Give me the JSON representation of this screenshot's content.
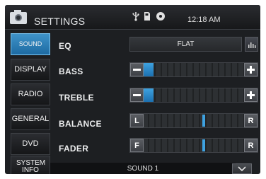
{
  "header": {
    "title": "SETTINGS",
    "time": "12:18 AM"
  },
  "sidebar": {
    "items": [
      {
        "label": "SOUND"
      },
      {
        "label": "DISPLAY"
      },
      {
        "label": "RADIO"
      },
      {
        "label": "GENERAL"
      },
      {
        "label": "DVD"
      },
      {
        "label": "SYSTEM INFO"
      }
    ]
  },
  "settings": {
    "eq": {
      "label": "EQ",
      "value": "FLAT"
    },
    "bass": {
      "label": "BASS",
      "level_fraction": 0.1
    },
    "treble": {
      "label": "TREBLE",
      "level_fraction": 0.1
    },
    "balance": {
      "label": "BALANCE",
      "left": "L",
      "right": "R",
      "position_fraction": 0.6
    },
    "fader": {
      "label": "FADER",
      "front": "F",
      "rear": "R",
      "position_fraction": 0.6
    }
  },
  "footer": {
    "preset": "SOUND 1"
  },
  "colors": {
    "accent": "#3ea2e0",
    "active_tab": "#2a7ab7"
  },
  "icons": [
    "camera-icon",
    "usb-icon",
    "sd-card-icon",
    "disc-icon",
    "eq-icon",
    "minus-icon",
    "plus-icon",
    "chevron-down-icon"
  ]
}
